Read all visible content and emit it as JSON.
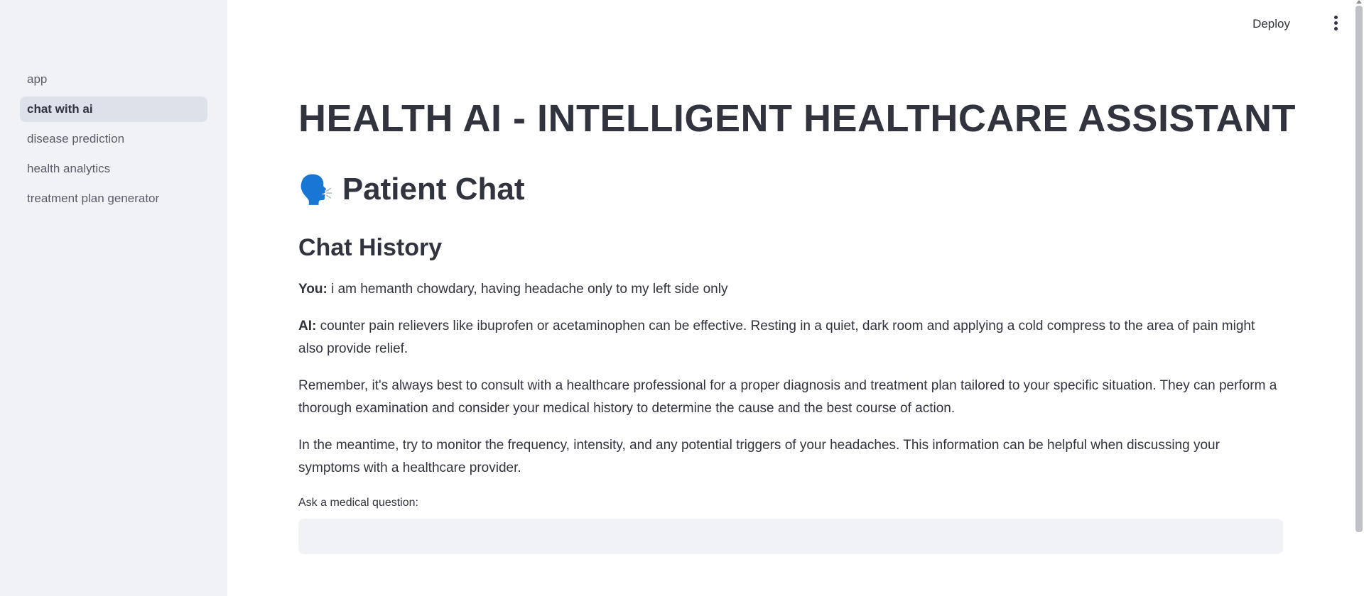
{
  "sidebar": {
    "items": [
      {
        "label": "app",
        "active": false
      },
      {
        "label": "chat with ai",
        "active": true
      },
      {
        "label": "disease prediction",
        "active": false
      },
      {
        "label": "health analytics",
        "active": false
      },
      {
        "label": "treatment plan generator",
        "active": false
      }
    ]
  },
  "header": {
    "deploy_label": "Deploy",
    "menu_icon": "vertical-ellipsis-icon"
  },
  "main": {
    "title": "HEALTH AI - INTELLIGENT HEALTHCARE ASSISTANT",
    "subtitle_icon": "🗣️",
    "subtitle": "Patient Chat",
    "section_title": "Chat History",
    "messages": [
      {
        "speaker": "You:",
        "text": " i am hemanth chowdary, having headache only to my left side only"
      },
      {
        "speaker": "AI:",
        "text": " counter pain relievers like ibuprofen or acetaminophen can be effective. Resting in a quiet, dark room and applying a cold compress to the area of pain might also provide relief."
      },
      {
        "speaker": "",
        "text": "Remember, it's always best to consult with a healthcare professional for a proper diagnosis and treatment plan tailored to your specific situation. They can perform a thorough examination and consider your medical history to determine the cause and the best course of action."
      },
      {
        "speaker": "",
        "text": "In the meantime, try to monitor the frequency, intensity, and any potential triggers of your headaches. This information can be helpful when discussing your symptoms with a healthcare provider."
      }
    ],
    "input_label": "Ask a medical question:",
    "input_value": ""
  },
  "colors": {
    "sidebar_bg": "#f0f2f6",
    "active_item_bg": "#dde1e9",
    "text": "#31333f",
    "input_bg": "#f0f2f6"
  }
}
